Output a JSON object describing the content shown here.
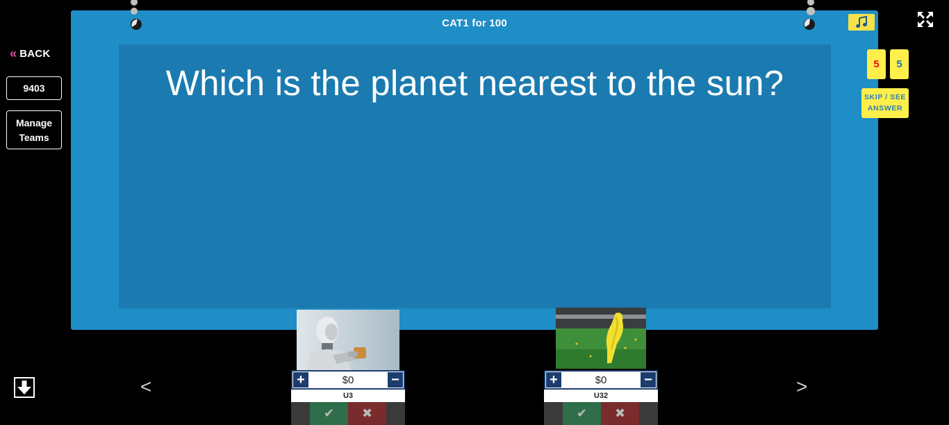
{
  "sidebar": {
    "back_label": "BACK",
    "game_code": "9403",
    "manage_teams_line1": "Manage",
    "manage_teams_line2": "Teams"
  },
  "board": {
    "title": "CAT1 for 100",
    "question": "Which is the planet nearest to the sun?"
  },
  "timers": {
    "red": "5",
    "blue": "5"
  },
  "skip_button": {
    "line1": "SKIP / SEE",
    "line2": "ANSWER"
  },
  "navigation": {
    "prev": "<",
    "next": ">"
  },
  "teams": [
    {
      "name": "U3",
      "score": "$0",
      "plus": "+",
      "minus": "−",
      "correct": "✔",
      "wrong": "✖"
    },
    {
      "name": "U32",
      "score": "$0",
      "plus": "+",
      "minus": "−",
      "correct": "✔",
      "wrong": "✖"
    }
  ],
  "icons": {
    "music": "music-note-icon",
    "fullscreen": "fullscreen-icon",
    "down": "down-arrow-icon",
    "back": "double-chevron-left-icon"
  },
  "colors": {
    "board": "#1f8dc6",
    "question_panel": "#1b7bb0",
    "accent_yellow": "#ffef4a",
    "timer_red": "#e8101a",
    "back_chevron": "#e0529a",
    "score_navy": "#1c3d6e"
  }
}
